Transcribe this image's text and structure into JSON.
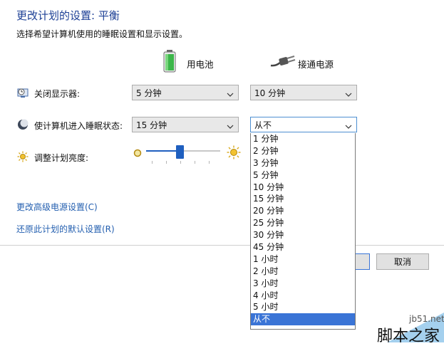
{
  "header": {
    "title": "更改计划的设置: 平衡",
    "subtitle": "选择希望计算机使用的睡眠设置和显示设置。"
  },
  "columns": {
    "battery_label": "用电池",
    "plugged_label": "接通电源"
  },
  "rows": {
    "display": {
      "label": "关闭显示器:",
      "battery_value": "5 分钟",
      "plugged_value": "10 分钟"
    },
    "sleep": {
      "label": "使计算机进入睡眠状态:",
      "battery_value": "15 分钟",
      "plugged_value": "从不"
    },
    "brightness": {
      "label": "调整计划亮度:",
      "level": 0.45
    }
  },
  "links": {
    "advanced": "更改高级电源设置(C)",
    "restore": "还原此计划的默认设置(R)"
  },
  "buttons": {
    "cancel": "取消"
  },
  "dropdown_options": [
    "1 分钟",
    "2 分钟",
    "3 分钟",
    "5 分钟",
    "10 分钟",
    "15 分钟",
    "20 分钟",
    "25 分钟",
    "30 分钟",
    "45 分钟",
    "1 小时",
    "2 小时",
    "3 小时",
    "4 小时",
    "5 小时",
    "从不"
  ],
  "dropdown_selected": "从不",
  "watermark": {
    "site": "jb51.net",
    "name": "脚本之家"
  },
  "colors": {
    "title": "#1c3f95",
    "link": "#2560b0",
    "selection": "#3a74d6",
    "slider": "#1f5fbf"
  }
}
